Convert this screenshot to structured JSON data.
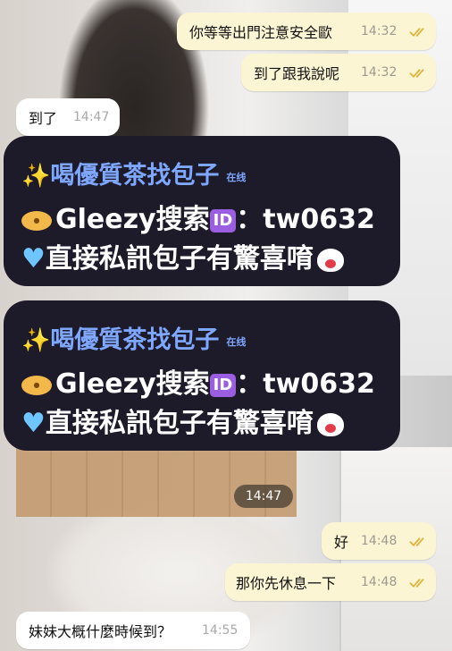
{
  "messages": [
    {
      "text": "你等等出門注意安全歐",
      "time": "14:32",
      "direction": "outgoing"
    },
    {
      "text": "到了跟我說呢",
      "time": "14:32",
      "direction": "outgoing"
    },
    {
      "text": "到了",
      "time": "14:47",
      "direction": "incoming"
    },
    {
      "text": "好",
      "time": "14:48",
      "direction": "outgoing"
    },
    {
      "text": "那你先休息一下",
      "time": "14:48",
      "direction": "outgoing"
    },
    {
      "text": "妹妹大概什麼時候到？",
      "time": "14:55",
      "direction": "incoming"
    }
  ],
  "image_message": {
    "time": "14:47"
  },
  "promo": {
    "line1": "喝優質茶找包子",
    "online_tag": "在线",
    "brand": "Gleezy",
    "line2_search": "搜索",
    "id_badge": "ID",
    "line2_id": "：tw0632",
    "line3": "直接私訊包子有驚喜唷"
  },
  "colors": {
    "outgoing_bubble": "#fbf5d3",
    "incoming_bubble": "#ffffff",
    "banner": "#1d1a2a",
    "banner_title": "#7ea7ff",
    "read_check": "#e0b23c"
  }
}
